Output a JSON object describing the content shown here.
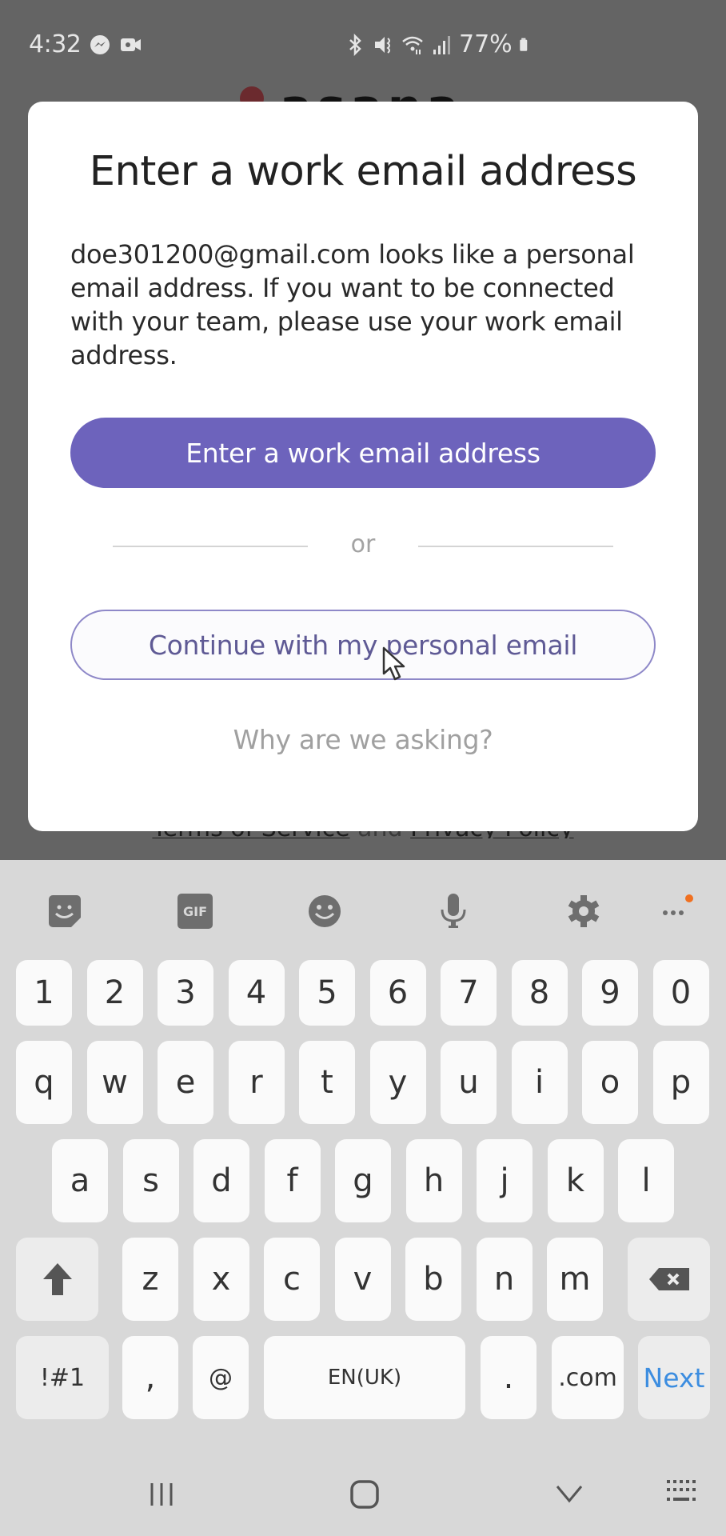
{
  "status_bar": {
    "time": "4:32",
    "battery_percent": "77%",
    "left_icons": [
      "messenger-icon",
      "video-call-icon"
    ],
    "right_icons": [
      "bluetooth-icon",
      "vibrate-icon",
      "wifi-icon",
      "signal-icon",
      "battery-icon"
    ]
  },
  "background": {
    "logo_text": "asana",
    "legal_link_1": "Terms of Service",
    "legal_and": "and",
    "legal_link_2": "Privacy Policy"
  },
  "modal": {
    "title": "Enter a work email address",
    "body": "doe301200@gmail.com looks like a personal email address. If you want to be connected with your team, please use your work email address.",
    "primary_button": "Enter a work email address",
    "divider_text": "or",
    "secondary_button": "Continue with my personal email",
    "help_link": "Why are we asking?",
    "colors": {
      "primary": "#6d63bc",
      "secondary_text": "#5f5a95"
    }
  },
  "keyboard": {
    "toolbar": [
      "sticker-icon",
      "gif-icon",
      "emoji-icon",
      "microphone-icon",
      "settings-icon",
      "more-icon"
    ],
    "gif_label": "GIF",
    "number_row": [
      "1",
      "2",
      "3",
      "4",
      "5",
      "6",
      "7",
      "8",
      "9",
      "0"
    ],
    "row1": [
      "q",
      "w",
      "e",
      "r",
      "t",
      "y",
      "u",
      "i",
      "o",
      "p"
    ],
    "row2": [
      "a",
      "s",
      "d",
      "f",
      "g",
      "h",
      "j",
      "k",
      "l"
    ],
    "row3": [
      "z",
      "x",
      "c",
      "v",
      "b",
      "n",
      "m"
    ],
    "bottom": {
      "symbols": "!#1",
      "comma": ",",
      "at": "@",
      "space": "EN(UK)",
      "period": ".",
      "dotcom": ".com",
      "action": "Next"
    },
    "action_color": "#3c8de0"
  },
  "navbar": [
    "recent-apps-icon",
    "home-icon",
    "back-icon",
    "keyboard-switch-icon"
  ]
}
